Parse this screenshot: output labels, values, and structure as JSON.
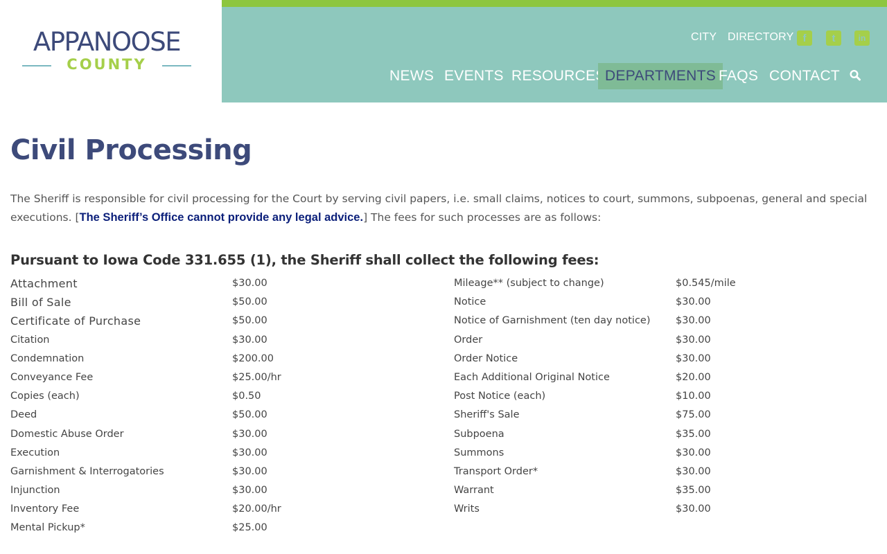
{
  "logo": {
    "top": "APPANOOSE",
    "bottom": "COUNTY"
  },
  "utility_nav": [
    {
      "label": "CITY"
    },
    {
      "label": "DIRECTORY"
    }
  ],
  "social": [
    {
      "icon": "facebook-icon",
      "glyph": "f"
    },
    {
      "icon": "twitter-icon",
      "glyph": "t"
    },
    {
      "icon": "linkedin-icon",
      "glyph": "in"
    }
  ],
  "main_nav": [
    {
      "label": "NEWS"
    },
    {
      "label": "EVENTS"
    },
    {
      "label": "RESOURCES"
    },
    {
      "label": "DEPARTMENTS",
      "active": true
    },
    {
      "label": "FAQS"
    },
    {
      "label": "CONTACT"
    }
  ],
  "page": {
    "title": "Civil Processing",
    "intro_before": "The Sheriff is responsible for civil processing for the Court by serving civil papers, i.e. small claims, notices to court, summons, subpoenas, general and special executions. [",
    "intro_strong": "The Sheriff’s Office cannot provide any legal advice.",
    "intro_after": "] The fees for such processes are as follows:",
    "subheading": "Pursuant to Iowa Code 331.655 (1), the Sheriff shall collect the following fees:"
  },
  "fees_left": [
    {
      "name": "Attachment",
      "amount": "$30.00"
    },
    {
      "name": "Bill of Sale",
      "amount": "$50.00"
    },
    {
      "name": "Certificate of Purchase",
      "amount": "$50.00"
    },
    {
      "name": "Citation",
      "amount": "$30.00"
    },
    {
      "name": "Condemnation",
      "amount": "$200.00"
    },
    {
      "name": "Conveyance Fee",
      "amount": "$25.00/hr"
    },
    {
      "name": "Copies (each)",
      "amount": "$0.50"
    },
    {
      "name": "Deed",
      "amount": "$50.00"
    },
    {
      "name": "Domestic Abuse Order",
      "amount": "$30.00"
    },
    {
      "name": "Execution",
      "amount": "$30.00"
    },
    {
      "name": "Garnishment & Interrogatories",
      "amount": "$30.00"
    },
    {
      "name": "Injunction",
      "amount": "$30.00"
    },
    {
      "name": "Inventory Fee",
      "amount": "$20.00/hr"
    },
    {
      "name": "Mental Pickup*",
      "amount": "$25.00"
    }
  ],
  "fees_right": [
    {
      "name": "Mileage** (subject to change)",
      "amount": "$0.545/mile"
    },
    {
      "name": "Notice",
      "amount": "$30.00"
    },
    {
      "name": "Notice of Garnishment (ten day notice)",
      "amount": "$30.00"
    },
    {
      "name": "Order",
      "amount": "$30.00"
    },
    {
      "name": "Order Notice",
      "amount": "$30.00"
    },
    {
      "name": "Each Additional Original Notice",
      "amount": "$20.00"
    },
    {
      "name": "Post Notice (each)",
      "amount": "$10.00"
    },
    {
      "name": "Sheriff's Sale",
      "amount": "$75.00"
    },
    {
      "name": "Subpoena",
      "amount": "$35.00"
    },
    {
      "name": "Summons",
      "amount": "$30.00"
    },
    {
      "name": "Transport Order*",
      "amount": "$30.00"
    },
    {
      "name": "Warrant",
      "amount": "$35.00"
    },
    {
      "name": "Writs",
      "amount": "$30.00"
    }
  ]
}
